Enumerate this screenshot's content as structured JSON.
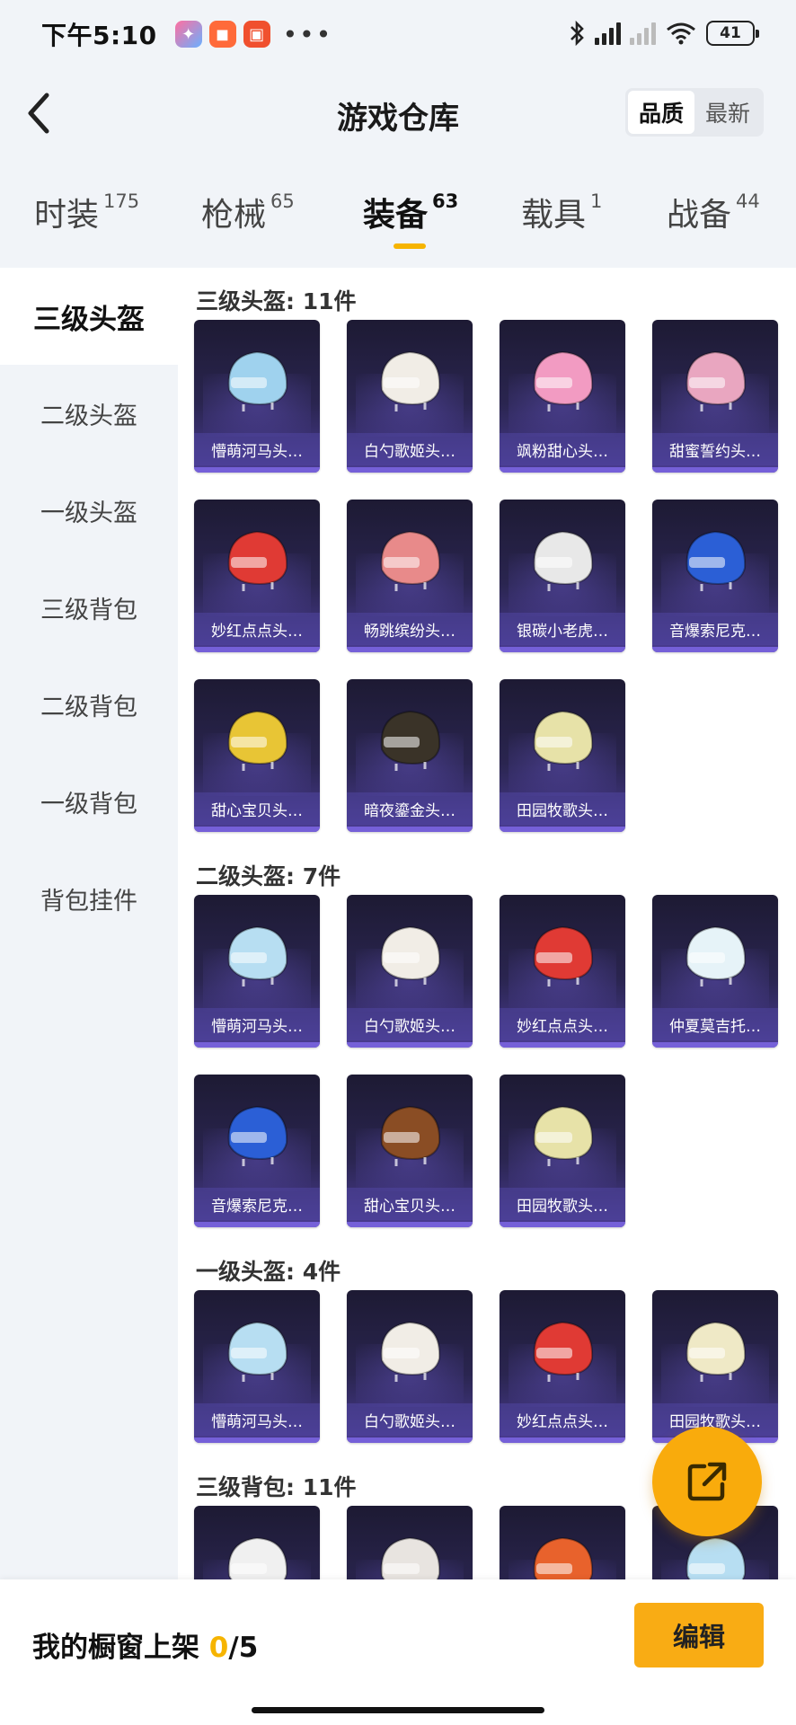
{
  "status_bar": {
    "time": "下午5:10",
    "battery": "41"
  },
  "header": {
    "title": "游戏仓库",
    "sort_options": [
      "品质",
      "最新"
    ],
    "active_sort": "品质"
  },
  "tabs": [
    {
      "label": "时装",
      "count": "175"
    },
    {
      "label": "枪械",
      "count": "65"
    },
    {
      "label": "装备",
      "count": "63",
      "active": true
    },
    {
      "label": "载具",
      "count": "1"
    },
    {
      "label": "战备",
      "count": "44"
    }
  ],
  "sidebar": {
    "items": [
      "三级头盔",
      "二级头盔",
      "一级头盔",
      "三级背包",
      "二级背包",
      "一级背包",
      "背包挂件"
    ],
    "active": "三级头盔"
  },
  "sections": [
    {
      "title": "三级头盔: 11件",
      "items": [
        {
          "name": "懵萌河马头…",
          "color": "#9fd2ee"
        },
        {
          "name": "白勺歌姬头…",
          "color": "#f1ede6"
        },
        {
          "name": "飒粉甜心头…",
          "color": "#f29bc2"
        },
        {
          "name": "甜蜜誓约头…",
          "color": "#e9a6c0"
        },
        {
          "name": "妙红点点头…",
          "color": "#e03a34"
        },
        {
          "name": "畅跳缤纷头…",
          "color": "#e88a8a"
        },
        {
          "name": "银碳小老虎…",
          "color": "#e8e8e8"
        },
        {
          "name": "音爆索尼克…",
          "color": "#2b5fd6"
        },
        {
          "name": "甜心宝贝头…",
          "color": "#e8c535"
        },
        {
          "name": "暗夜鎏金头…",
          "color": "#3a3328"
        },
        {
          "name": "田园牧歌头…",
          "color": "#e7e2a8"
        }
      ]
    },
    {
      "title": "二级头盔: 7件",
      "items": [
        {
          "name": "懵萌河马头…",
          "color": "#b7def2"
        },
        {
          "name": "白勺歌姬头…",
          "color": "#f1ede6"
        },
        {
          "name": "妙红点点头…",
          "color": "#e03a34"
        },
        {
          "name": "仲夏莫吉托…",
          "color": "#e6f3f8"
        },
        {
          "name": "音爆索尼克…",
          "color": "#2b5fd6"
        },
        {
          "name": "甜心宝贝头…",
          "color": "#8a4d24"
        },
        {
          "name": "田园牧歌头…",
          "color": "#e7e2a8"
        }
      ]
    },
    {
      "title": "一级头盔: 4件",
      "items": [
        {
          "name": "懵萌河马头…",
          "color": "#b7def2"
        },
        {
          "name": "白勺歌姬头…",
          "color": "#f1ede6"
        },
        {
          "name": "妙红点点头…",
          "color": "#e03a34"
        },
        {
          "name": "田园牧歌头…",
          "color": "#efe9c6"
        }
      ]
    },
    {
      "title": "三级背包: 11件",
      "items": [
        {
          "name": "",
          "color": "#f0f0f0"
        },
        {
          "name": "",
          "color": "#e8e4e0"
        },
        {
          "name": "",
          "color": "#e8622c"
        },
        {
          "name": "",
          "color": "#b7def2"
        }
      ]
    }
  ],
  "bottom": {
    "label": "我的橱窗上架 ",
    "count": "0",
    "total": "/5",
    "edit_label": "编辑"
  },
  "colors": {
    "accent": "#f6b400",
    "card_bg": "#2a2550"
  }
}
